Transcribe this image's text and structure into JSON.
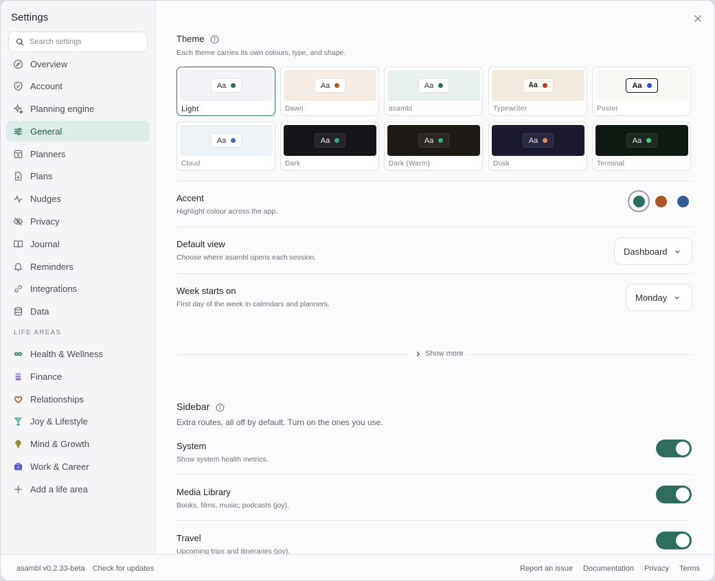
{
  "sidebar": {
    "title": "Settings",
    "search_placeholder": "Search settings",
    "items": [
      {
        "label": "Overview",
        "icon": "compass-icon"
      },
      {
        "label": "Account",
        "icon": "shield-icon"
      },
      {
        "label": "Planning engine",
        "icon": "sparkle-icon"
      },
      {
        "label": "General",
        "icon": "sliders-icon",
        "active": true
      },
      {
        "label": "Planners",
        "icon": "calendar-icon"
      },
      {
        "label": "Plans",
        "icon": "file-icon"
      },
      {
        "label": "Nudges",
        "icon": "pulse-icon"
      },
      {
        "label": "Privacy",
        "icon": "eye-off-icon"
      },
      {
        "label": "Journal",
        "icon": "book-icon"
      },
      {
        "label": "Reminders",
        "icon": "bell-icon"
      },
      {
        "label": "Integrations",
        "icon": "link-icon"
      },
      {
        "label": "Data",
        "icon": "database-icon"
      }
    ],
    "life_areas_label": "LIFE AREAS",
    "life_areas": [
      {
        "label": "Health & Wellness",
        "color": "#3f8f5a"
      },
      {
        "label": "Finance",
        "color": "#9b7bc8"
      },
      {
        "label": "Relationships",
        "color": "#d0553f"
      },
      {
        "label": "Joy & Lifestyle",
        "color": "#3a9a9a"
      },
      {
        "label": "Mind & Growth",
        "color": "#b38c2e"
      },
      {
        "label": "Work & Career",
        "color": "#5a63c0"
      }
    ],
    "add_area_label": "Add a life area"
  },
  "footer": {
    "version": "asambl v0.2.33-beta",
    "check_updates": "Check for updates",
    "report": "Report an issue",
    "docs": "Documentation",
    "privacy": "Privacy",
    "terms": "Terms"
  },
  "theme": {
    "title": "Theme",
    "subtitle": "Each theme carries its own colours, type, and shape.",
    "chip_text": "Aa",
    "cards": [
      {
        "name": "Light",
        "bg": "#f3f3f7",
        "chip_bg": "#ffffff",
        "chip_fg": "#2b2d31",
        "dot": "#2f6e5c",
        "selected": true
      },
      {
        "name": "Dawn",
        "bg": "#f7ece4",
        "chip_bg": "#ffffff",
        "chip_fg": "#2b2d31",
        "dot": "#a8572b"
      },
      {
        "name": "asambl",
        "bg": "#e8f1ed",
        "chip_bg": "#ffffff",
        "chip_fg": "#2b2d31",
        "dot": "#2f6e5c"
      },
      {
        "name": "Typewriter",
        "bg": "#f1ebde",
        "chip_bg": "#fbf8f1",
        "chip_fg": "#1f2125",
        "dot": "#b4442c"
      },
      {
        "name": "Poster",
        "bg": "#f8f8f5",
        "chip_bg": "#ffffff",
        "chip_fg": "#111111",
        "dot": "#2f4fd8"
      },
      {
        "name": "Cloud",
        "bg": "#edf2f7",
        "chip_bg": "#ffffff",
        "chip_fg": "#2b2d31",
        "dot": "#4a66b5"
      },
      {
        "name": "Dark",
        "bg": "#15161a",
        "chip_bg": "#23252b",
        "chip_fg": "#e7e8ec",
        "dot": "#3aa68a"
      },
      {
        "name": "Dark (Warm)",
        "bg": "#1e1b16",
        "chip_bg": "#2c2821",
        "chip_fg": "#ece6da",
        "dot": "#3aa68a"
      },
      {
        "name": "Dusk",
        "bg": "#1a1930",
        "chip_bg": "#292842",
        "chip_fg": "#e6e4f2",
        "dot": "#e38a6a"
      },
      {
        "name": "Terminal",
        "bg": "#0f1a13",
        "chip_bg": "#1b2a20",
        "chip_fg": "#d9e8dd",
        "dot": "#3fd07a"
      }
    ]
  },
  "accent": {
    "title": "Accent",
    "subtitle": "Highlight colour across the app.",
    "swatches": [
      "#2f6e5c",
      "#a8572b",
      "#2f5f93"
    ]
  },
  "default_view": {
    "title": "Default view",
    "subtitle": "Choose where asambl opens each session.",
    "value": "Dashboard"
  },
  "week_start": {
    "title": "Week starts on",
    "subtitle": "First day of the week in calendars and planners.",
    "value": "Monday"
  },
  "show_more": "Show more",
  "sidebar_section": {
    "title": "Sidebar",
    "subtitle": "Extra routes, all off by default. Turn on the ones you use.",
    "toggles": [
      {
        "title": "System",
        "subtitle": "Show system health metrics.",
        "on": true
      },
      {
        "title": "Media Library",
        "subtitle": "Books, films, music, podcasts (joy).",
        "on": true
      },
      {
        "title": "Travel",
        "subtitle": "Upcoming trips and itineraries (joy).",
        "on": true
      }
    ]
  },
  "colors": {
    "accent": "#2f6e5c",
    "active_bg": "#dcece6"
  }
}
